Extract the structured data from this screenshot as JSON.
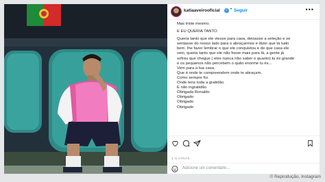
{
  "post": {
    "username": "katiaaveirooficial",
    "verified_mark": "✓",
    "separator": "•",
    "follow_label": "Seguir",
    "more_icon": "more-options-icon",
    "caption_lines": [
      "Mas triste mesmo.",
      "E EU QUERIA TANTO.",
      "Queria tanto que ele viesse para casa, deixasse a seleção e se",
      "sentasse do nosso lado para o abraçarmos e dizer que tá tudo",
      "bem. Ihe fazer lembrar o que ele conquistou e de que casa ele",
      "veio, queria tanto que ele não fosse mais para lá, a gente já",
      "sofreu que chegue ( eles nunca irão saber o quanto) tu és grande",
      "e os pequenos não percebem o quão enorme tu és...",
      "Vem para a tua casa.",
      "Que é onde te compreendem onde te abraçam.",
      "Como sempre foi.",
      "Onde tens toda a gratidão.",
      "E não ingratidão.",
      "Obrigada Ronaldo",
      "Obrigado",
      "Obrigado",
      "Obrigado"
    ],
    "date": "1 H ATRÁS",
    "comment_placeholder": "Adicione um comentário..."
  },
  "credit": "© Reprodução, Instagram",
  "icons": [
    "heart-icon",
    "comment-icon",
    "share-icon",
    "bookmark-icon",
    "emoji-icon"
  ]
}
